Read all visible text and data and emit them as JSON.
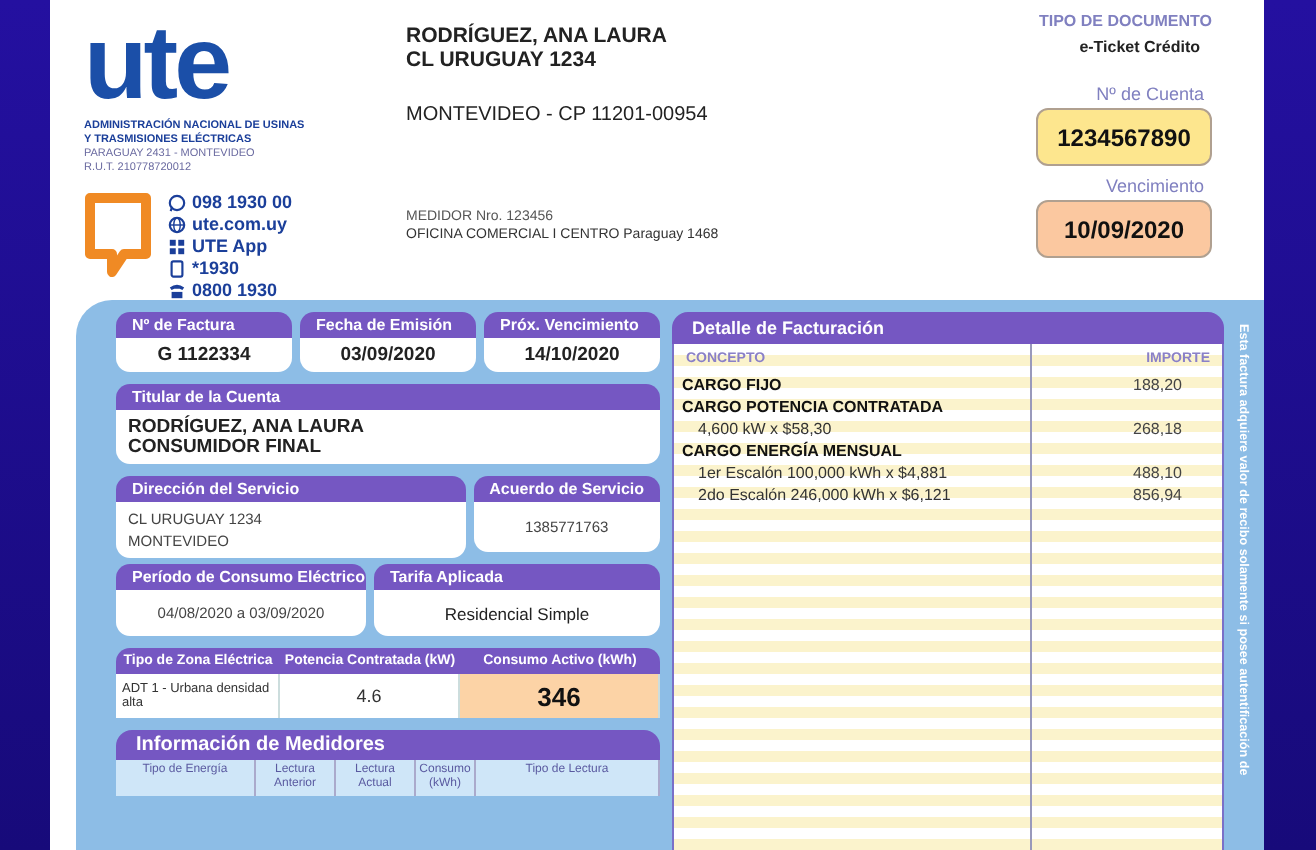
{
  "header": {
    "logo": "ute",
    "org_lines": [
      "ADMINISTRACIÓN NACIONAL DE USINAS",
      "Y TRASMISIONES ELÉCTRICAS"
    ],
    "org_address": "PARAGUAY 2431 - MONTEVIDEO",
    "org_rut": "R.U.T. 210778720012",
    "contacts": [
      {
        "kind": "whatsapp",
        "text": "098 1930 00"
      },
      {
        "kind": "web",
        "text": "ute.com.uy"
      },
      {
        "kind": "app",
        "text": "UTE App"
      },
      {
        "kind": "mobile",
        "text": "*1930"
      },
      {
        "kind": "phone",
        "text": "0800 1930"
      }
    ]
  },
  "recipient": {
    "name": "RODRÍGUEZ, ANA LAURA",
    "street": "CL URUGUAY 1234",
    "city": "MONTEVIDEO - CP 11201-00954",
    "meter": "MEDIDOR Nro. 123456",
    "office": "OFICINA COMERCIAL I CENTRO Paraguay 1468"
  },
  "document": {
    "type_label": "TIPO DE DOCUMENTO",
    "type_value": "e-Ticket Crédito",
    "account_label": "Nº de Cuenta",
    "account": "1234567890",
    "due_label": "Vencimiento",
    "due": "10/09/2020"
  },
  "invoice": [
    {
      "label": "Nº de Factura",
      "value": "G 1122334"
    },
    {
      "label": "Fecha de Emisión",
      "value": "03/09/2020"
    },
    {
      "label": "Próx. Vencimiento",
      "value": "14/10/2020"
    }
  ],
  "holder": {
    "label": "Titular de la Cuenta",
    "lines": [
      "RODRÍGUEZ, ANA LAURA",
      "CONSUMIDOR FINAL"
    ]
  },
  "service_address": {
    "label": "Dirección del Servicio",
    "lines": [
      "CL URUGUAY 1234",
      "MONTEVIDEO"
    ]
  },
  "service_agreement": {
    "label": "Acuerdo de Servicio",
    "value": "1385771763"
  },
  "period": {
    "label": "Período de Consumo Eléctrico",
    "value": "04/08/2020 a 03/09/2020"
  },
  "tariff": {
    "label": "Tarifa Aplicada",
    "value": "Residencial Simple"
  },
  "consumption": {
    "columns": [
      "Tipo de Zona Eléctrica",
      "Potencia Contratada (kW)",
      "Consumo Activo (kWh)"
    ],
    "values": [
      "ADT 1 - Urbana densidad alta",
      "4.6",
      "346"
    ]
  },
  "meters": {
    "title": "Información de Medidores",
    "columns": [
      "Tipo de Energía",
      "Lectura Anterior",
      "Lectura Actual",
      "Consumo (kWh)",
      "Tipo de Lectura"
    ]
  },
  "billing": {
    "title": "Detalle de Facturación",
    "columns": [
      "CONCEPTO",
      "IMPORTE"
    ],
    "rows": [
      {
        "kind": "group",
        "concept": "CARGO FIJO",
        "amount": "188,20"
      },
      {
        "kind": "group",
        "concept": "CARGO POTENCIA CONTRATADA"
      },
      {
        "kind": "item",
        "concept": "4,600 kW x $58,30",
        "amount": "268,18"
      },
      {
        "kind": "group",
        "concept": "CARGO ENERGÍA MENSUAL"
      },
      {
        "kind": "item",
        "concept": "1er Escalón 100,000 kWh x $4,881",
        "amount": "488,10"
      },
      {
        "kind": "item",
        "concept": "2do Escalón 246,000 kWh x $6,121",
        "amount": "856,94"
      }
    ]
  },
  "side_note": "Esta factura adquiere valor de recibo solamente si posee autentificación de"
}
